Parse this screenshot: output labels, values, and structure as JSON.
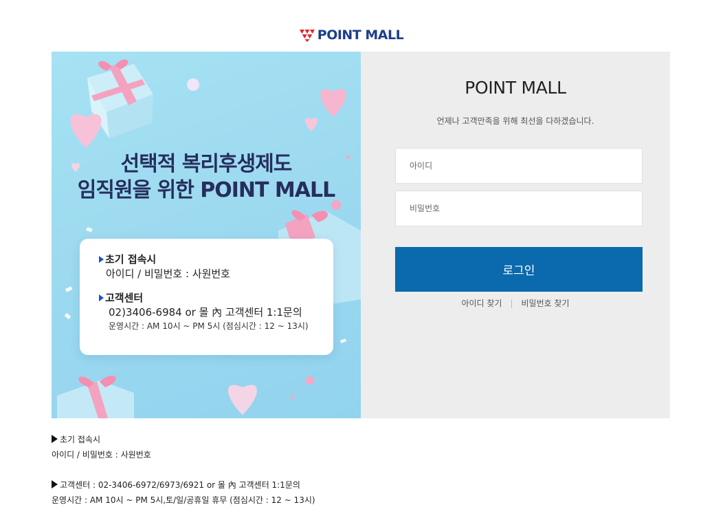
{
  "header": {
    "logo_text": "POINT MALL",
    "logo_icon": "pointmall-logo-icon",
    "brand_color": "#1d3f8c",
    "accent_color": "#e0242b"
  },
  "banner": {
    "title_line1": "선택적 복리후생제도",
    "title_line2": "임직원을 위한 POINT MALL",
    "card": {
      "section1_heading": "초기 접속시",
      "section1_text": "아이디 / 비밀번호 : 사원번호",
      "section2_heading": "고객센터",
      "section2_text": "02)3406-6984 or 몰 內 고객센터 1:1문의",
      "section2_hours": "운영시간 : AM 10시 ~ PM 5시 (점심시간 : 12 ~ 13시)"
    },
    "background_color": "#9ddaf0"
  },
  "login": {
    "title": "POINT MALL",
    "subtitle": "언제나 고객만족을 위해 최선을 다하겠습니다.",
    "id_placeholder": "아이디",
    "password_placeholder": "비밀번호",
    "login_button": "로그인",
    "find_id": "아이디 찾기",
    "find_password": "비밀번호 찾기",
    "button_color": "#0b69ad",
    "panel_color": "#ededed"
  },
  "footer_info": {
    "line1": "초기 접속시",
    "line2": "아이디 / 비밀번호 : 사원번호",
    "line3": "고객센터 : 02-3406-6972/6973/6921 or 몰 內 고객센터 1:1문의",
    "line4": "운영시간 : AM 10시 ~ PM 5시,토/일/공휴일 휴무 (점심시간 : 12 ~ 13시)"
  }
}
